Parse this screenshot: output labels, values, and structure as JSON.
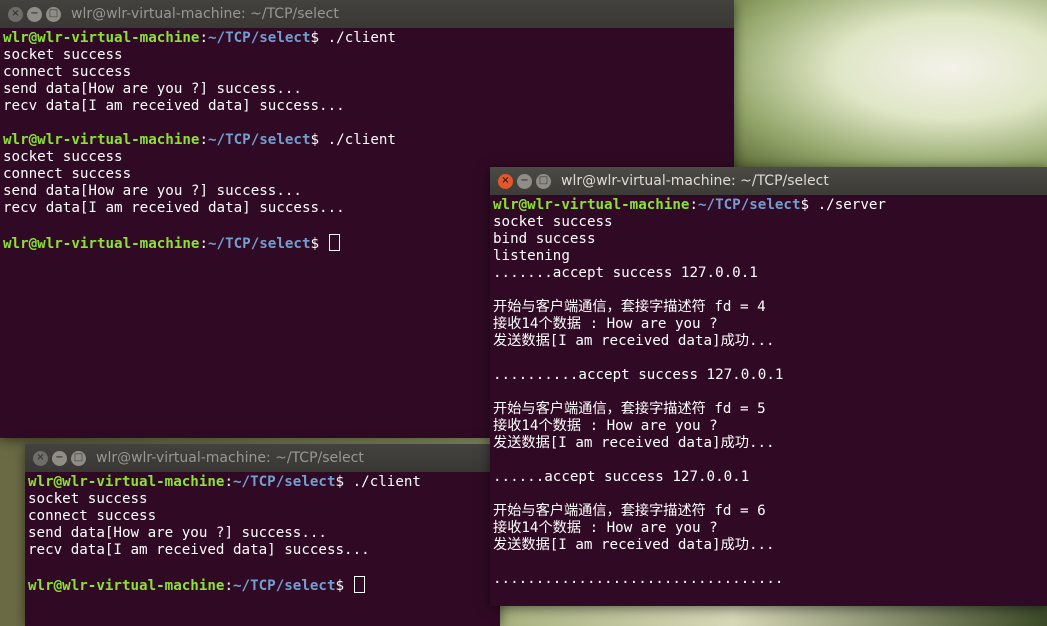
{
  "windows": {
    "client1": {
      "title": "wlr@wlr-virtual-machine: ~/TCP/select",
      "lines": [
        {
          "prompt_user": "wlr@wlr-virtual-machine",
          "prompt_sep": ":",
          "prompt_path": "~/TCP/select",
          "prompt_end": "$ ",
          "cmd": "./client"
        },
        {
          "text": "socket success"
        },
        {
          "text": "connect success"
        },
        {
          "text": "send data[How are you ?] success..."
        },
        {
          "text": "recv data[I am received data] success..."
        },
        {
          "text": ""
        },
        {
          "prompt_user": "wlr@wlr-virtual-machine",
          "prompt_sep": ":",
          "prompt_path": "~/TCP/select",
          "prompt_end": "$ ",
          "cmd": "./client"
        },
        {
          "text": "socket success"
        },
        {
          "text": "connect success"
        },
        {
          "text": "send data[How are you ?] success..."
        },
        {
          "text": "recv data[I am received data] success..."
        },
        {
          "text": ""
        },
        {
          "prompt_user": "wlr@wlr-virtual-machine",
          "prompt_sep": ":",
          "prompt_path": "~/TCP/select",
          "prompt_end": "$ ",
          "cmd": "",
          "cursor": true
        }
      ]
    },
    "client2": {
      "title": "wlr@wlr-virtual-machine: ~/TCP/select",
      "lines": [
        {
          "prompt_user": "wlr@wlr-virtual-machine",
          "prompt_sep": ":",
          "prompt_path": "~/TCP/select",
          "prompt_end": "$ ",
          "cmd": "./client"
        },
        {
          "text": "socket success"
        },
        {
          "text": "connect success"
        },
        {
          "text": "send data[How are you ?] success..."
        },
        {
          "text": "recv data[I am received data] success..."
        },
        {
          "text": ""
        },
        {
          "prompt_user": "wlr@wlr-virtual-machine",
          "prompt_sep": ":",
          "prompt_path": "~/TCP/select",
          "prompt_end": "$ ",
          "cmd": "",
          "cursor": true
        }
      ]
    },
    "server": {
      "title": "wlr@wlr-virtual-machine: ~/TCP/select",
      "lines": [
        {
          "prompt_user": "wlr@wlr-virtual-machine",
          "prompt_sep": ":",
          "prompt_path": "~/TCP/select",
          "prompt_end": "$ ",
          "cmd": "./server"
        },
        {
          "text": "socket success"
        },
        {
          "text": "bind success"
        },
        {
          "text": "listening"
        },
        {
          "text": ".......accept success 127.0.0.1"
        },
        {
          "text": ""
        },
        {
          "text": "开始与客户端通信，套接字描述符 fd = 4"
        },
        {
          "text": "接收14个数据 : How are you ?"
        },
        {
          "text": "发送数据[I am received data]成功..."
        },
        {
          "text": ""
        },
        {
          "text": "..........accept success 127.0.0.1"
        },
        {
          "text": ""
        },
        {
          "text": "开始与客户端通信，套接字描述符 fd = 5"
        },
        {
          "text": "接收14个数据 : How are you ?"
        },
        {
          "text": "发送数据[I am received data]成功..."
        },
        {
          "text": ""
        },
        {
          "text": "......accept success 127.0.0.1"
        },
        {
          "text": ""
        },
        {
          "text": "开始与客户端通信，套接字描述符 fd = 6"
        },
        {
          "text": "接收14个数据 : How are you ?"
        },
        {
          "text": "发送数据[I am received data]成功..."
        },
        {
          "text": ""
        },
        {
          "text": ".................................."
        }
      ]
    }
  },
  "colors": {
    "terminal_bg": "#300a24",
    "prompt_user": "#8ae234",
    "prompt_path": "#729fcf",
    "close_button": "#e2572b"
  },
  "icons": [
    "close-icon",
    "minimize-icon",
    "maximize-icon"
  ]
}
